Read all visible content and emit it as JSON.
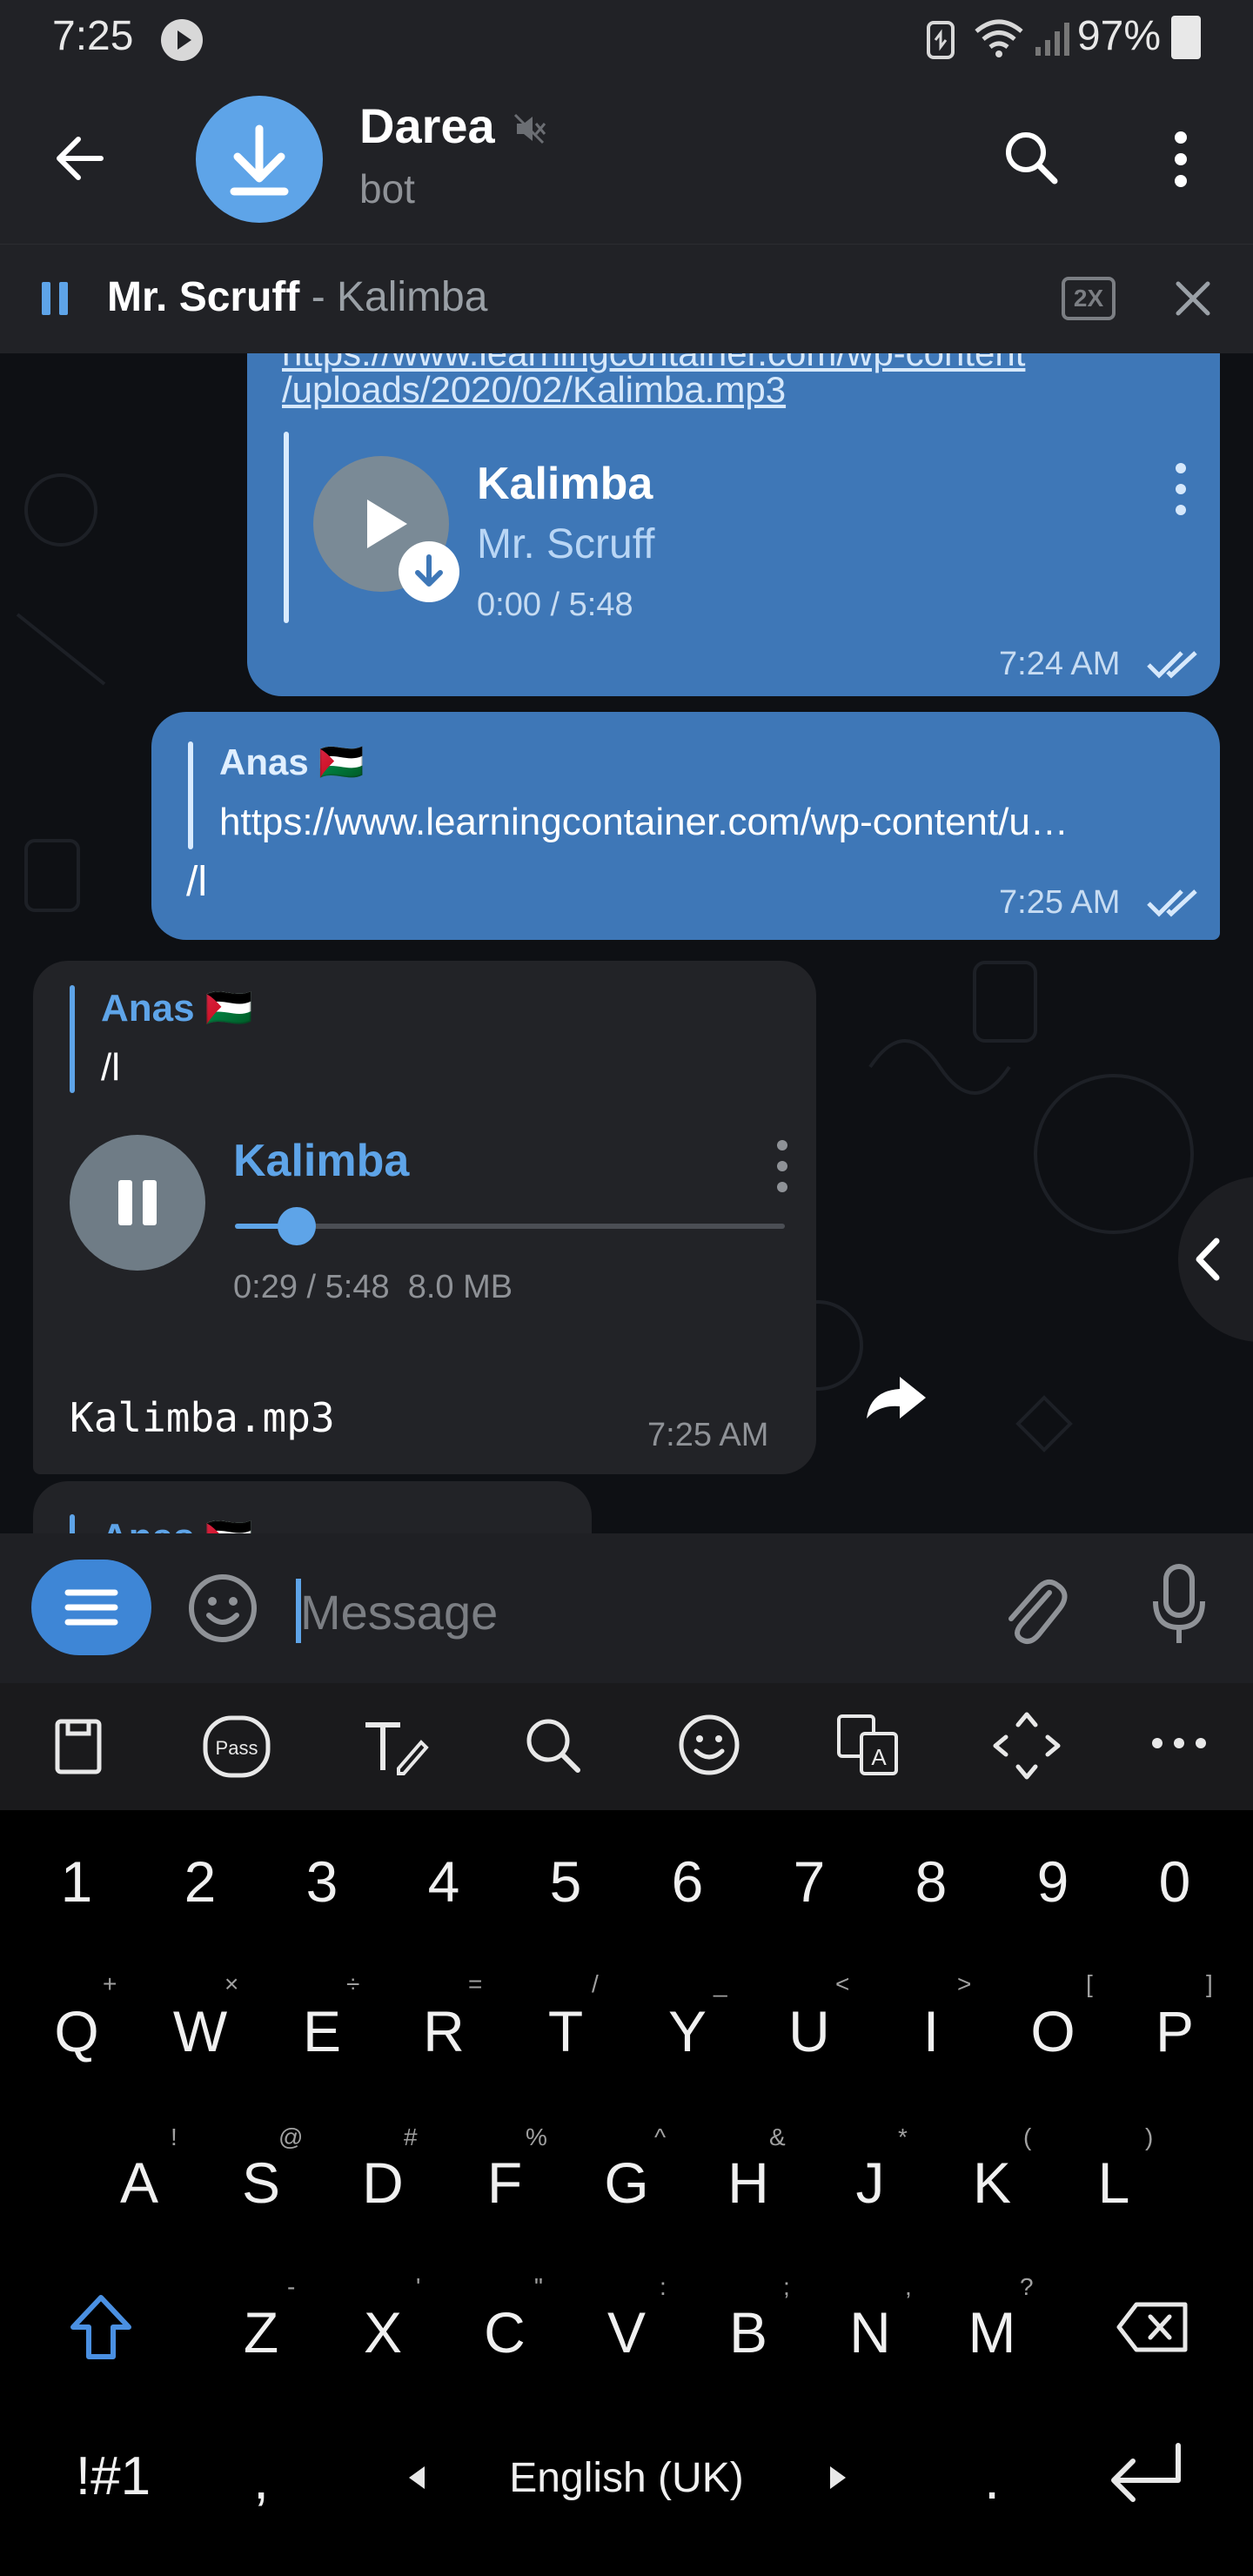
{
  "status_bar": {
    "time": "7:25",
    "battery": "97%"
  },
  "header": {
    "title": "Darea",
    "subtitle": "bot"
  },
  "player": {
    "artist": "Mr. Scruff",
    "separator": " - ",
    "title": "Kalimba",
    "speed": "2X"
  },
  "messages": {
    "m1": {
      "link_line1": "https://www.learningcontainer.com/wp-content",
      "link_line2": "/uploads/2020/02/Kalimba.mp3",
      "audio_title": "Kalimba",
      "audio_artist": "Mr. Scruff",
      "audio_time": "0:00 / 5:48",
      "time": "7:24 AM"
    },
    "m2": {
      "reply_name": "Anas 🇵🇸",
      "reply_text": "https://www.learningcontainer.com/wp-content/u…",
      "text": "/l",
      "time": "7:25 AM"
    },
    "m3": {
      "reply_name": "Anas 🇵🇸",
      "reply_text": "/l",
      "audio_title": "Kalimba",
      "audio_info": "0:29 / 5:48  8.0 MB",
      "progress": 0.09,
      "filename": "Kalimba.mp3",
      "time": "7:25 AM"
    },
    "m4": {
      "reply_name": "Anas 🇵🇸"
    }
  },
  "composer": {
    "placeholder": "Message"
  },
  "keyboard": {
    "numbers": [
      "1",
      "2",
      "3",
      "4",
      "5",
      "6",
      "7",
      "8",
      "9",
      "0"
    ],
    "row1": [
      "Q",
      "W",
      "E",
      "R",
      "T",
      "Y",
      "U",
      "I",
      "O",
      "P"
    ],
    "row1_sub": [
      "+",
      "×",
      "÷",
      "=",
      "/",
      "_",
      "<",
      ">",
      "[",
      "]"
    ],
    "row2": [
      "A",
      "S",
      "D",
      "F",
      "G",
      "H",
      "J",
      "K",
      "L"
    ],
    "row2_sub": [
      "!",
      "@",
      "#",
      "%",
      "^",
      "&",
      "*",
      "(",
      ")"
    ],
    "row3": [
      "Z",
      "X",
      "C",
      "V",
      "B",
      "N",
      "M"
    ],
    "row3_sub": [
      "-",
      "'",
      "\"",
      ":",
      ";",
      ",",
      "?"
    ],
    "sym": "!#1",
    "comma": ",",
    "language": "English (UK)",
    "period": "."
  },
  "colors": {
    "accent": "#5ea4e8",
    "outgoing": "#3e77b7",
    "incoming": "#222327",
    "background": "#0e1014"
  }
}
